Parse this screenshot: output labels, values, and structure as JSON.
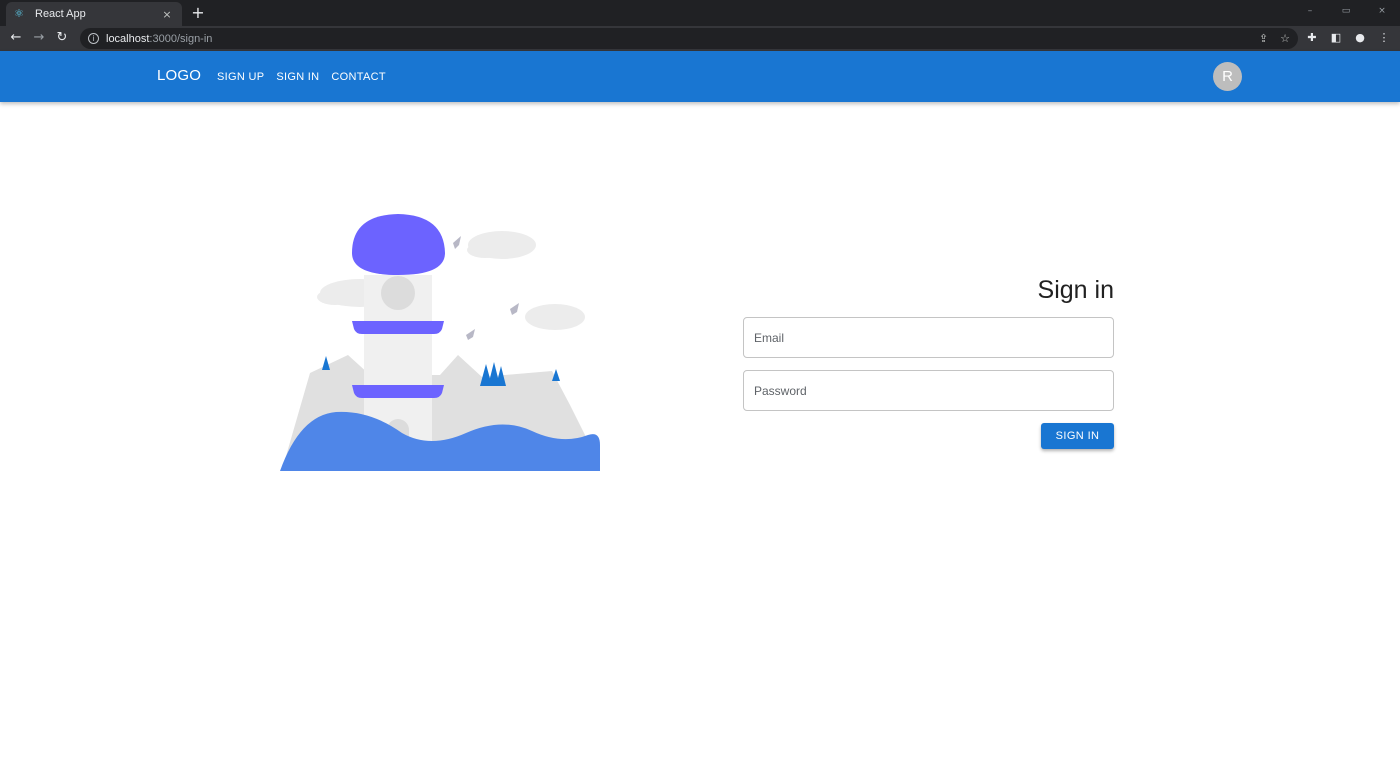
{
  "browser": {
    "tab_title": "React App",
    "tab_favicon": "react-atom-icon",
    "tab_close": "×",
    "new_tab": "+",
    "url_host": "localhost",
    "url_path": ":3000/sign-in",
    "window_controls": [
      "–",
      "▭",
      "×"
    ]
  },
  "appbar": {
    "logo": "LOGO",
    "nav": [
      "SIGN UP",
      "SIGN IN",
      "CONTACT"
    ],
    "avatar_letter": "R",
    "bar_color": "#1976d2"
  },
  "illustration": {
    "icon": "lighthouse-illustration",
    "accent_color": "#6c63ff",
    "water_color": "#4f86e8"
  },
  "form": {
    "title": "Sign in",
    "email_placeholder": "Email",
    "password_placeholder": "Password",
    "submit_label": "SIGN IN"
  }
}
